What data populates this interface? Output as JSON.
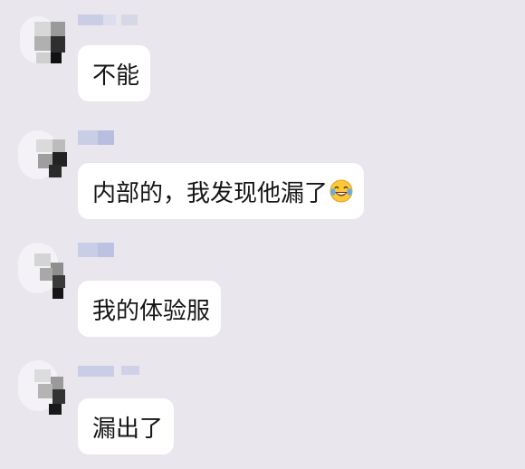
{
  "messages": [
    {
      "text": "不能",
      "emoji": null
    },
    {
      "text": "内部的，我发现他漏了",
      "emoji": "tears-of-joy-emoji"
    },
    {
      "text": "我的体验服",
      "emoji": null
    },
    {
      "text": "漏出了",
      "emoji": null
    }
  ],
  "colors": {
    "background": "#e9e6ee",
    "bubble": "#ffffff",
    "text": "#161616",
    "name_blur": "#c9cde6"
  }
}
